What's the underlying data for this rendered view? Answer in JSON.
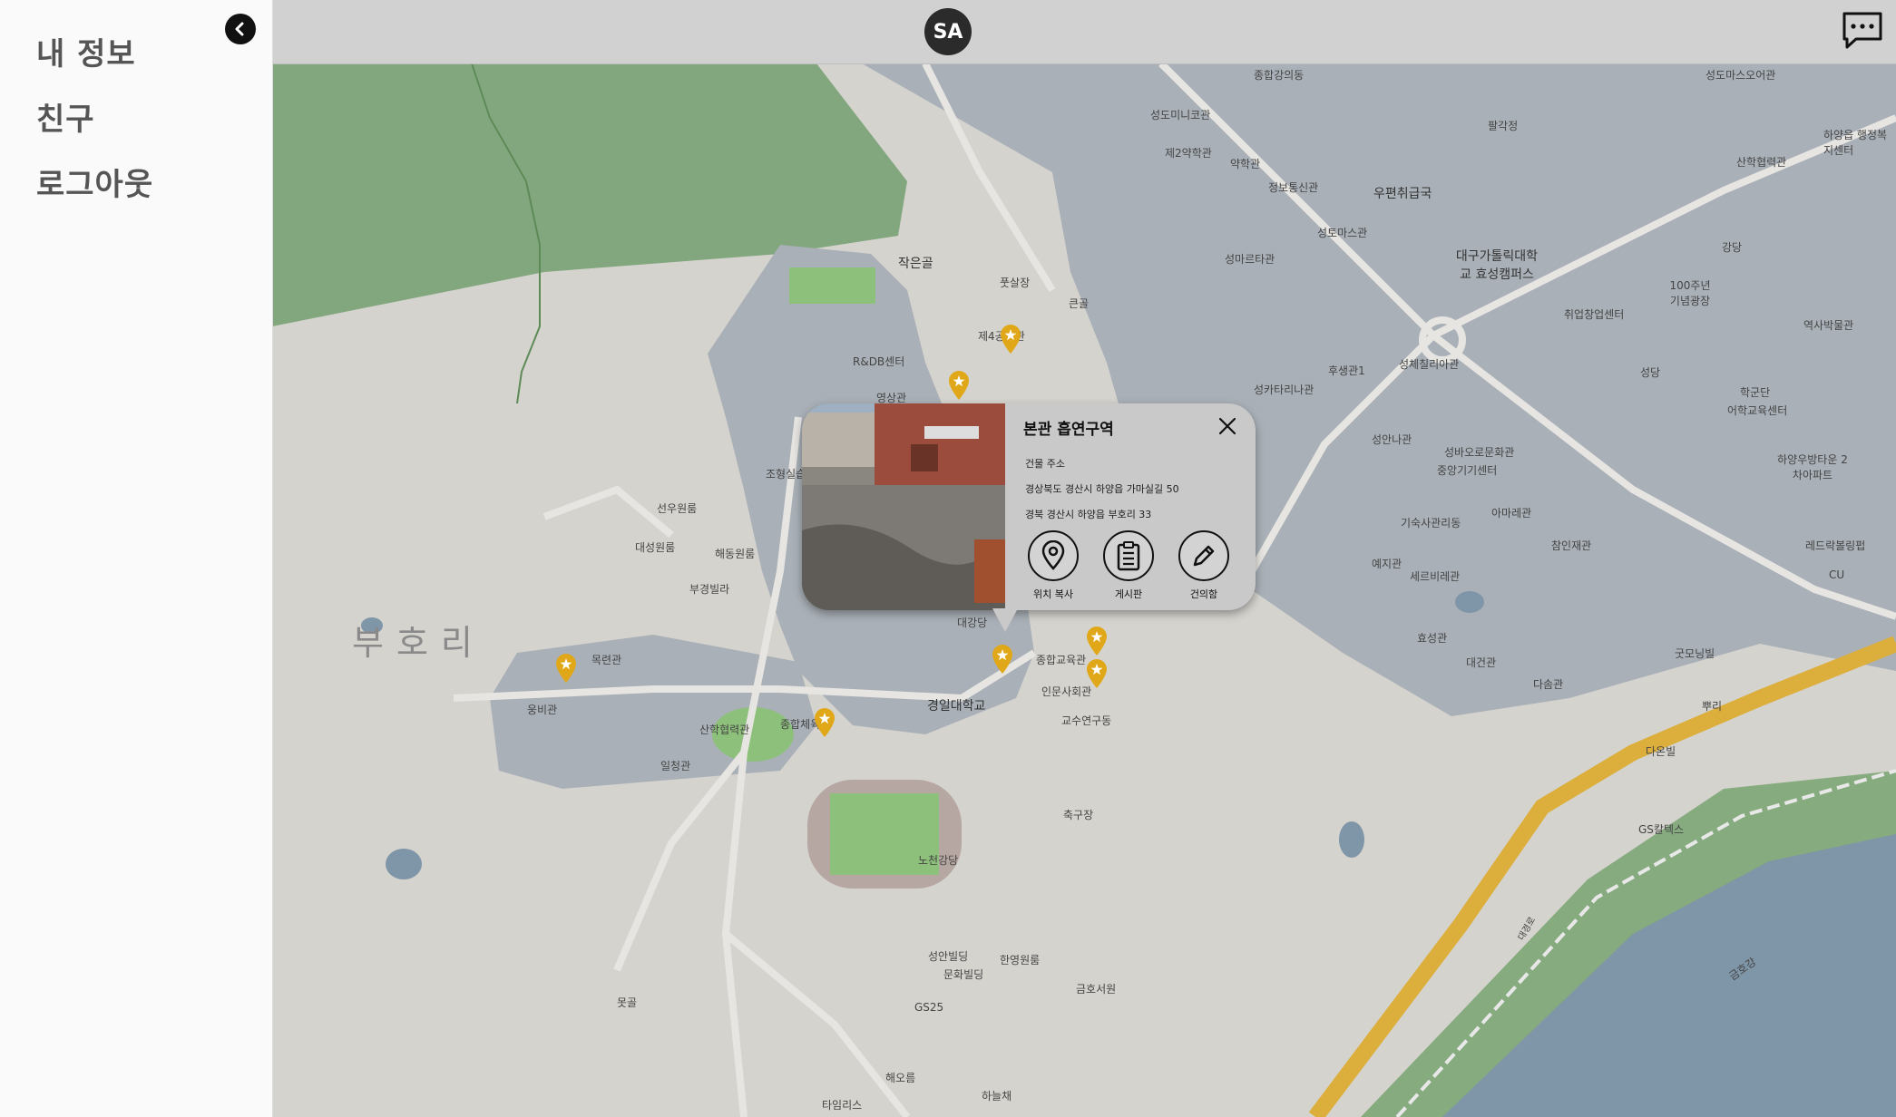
{
  "sidebar": {
    "items": [
      {
        "label": "내 정보"
      },
      {
        "label": "친구"
      },
      {
        "label": "로그아웃"
      }
    ]
  },
  "header": {
    "avatar_initials": "SA"
  },
  "map": {
    "region_label": "부호리",
    "labels": [
      "종합강의동",
      "성도마스오어관",
      "성도미니코관",
      "팔각정",
      "하양읍 행정복지센터",
      "제2약학관",
      "약학관",
      "정보통신관",
      "우편취급국",
      "산학협력관",
      "성토마스관",
      "성마르타관",
      "대구가톨릭대학교 효성캠퍼스",
      "강당",
      "100주년 기념광장",
      "작은골",
      "풋살장",
      "큰골",
      "취업창업센터",
      "역사박물관",
      "제4공학관",
      "R&DB센터",
      "후생관1",
      "성체칠리아관",
      "성카타리나관",
      "성당",
      "학군단",
      "어학교육센터",
      "영상관",
      "성안나관",
      "성바오로문화관",
      "하양우방타운 2차아파트",
      "조형실습관",
      "중앙기기센터",
      "선우원룸",
      "아마레관",
      "기숙사관리동",
      "대성원룸",
      "해동원룸",
      "예지관",
      "참인재관",
      "레드락볼링펍",
      "세르비레관",
      "부경빌라",
      "CU",
      "대강당",
      "효성관",
      "대건관",
      "다솜관",
      "굿모닝빌",
      "목련관",
      "종합교육관",
      "웅비관",
      "뿌리",
      "경일대학교",
      "인문사회관",
      "산학협력관",
      "종합체육관",
      "교수연구동",
      "일청관",
      "다온빌",
      "축구장",
      "GS칼텍스",
      "노천강당",
      "성안빌딩",
      "한영원룸",
      "문화빌딩",
      "금호서원",
      "GS25",
      "못골",
      "해오름",
      "하늘채",
      "타임리스",
      "금호강",
      "대경로"
    ]
  },
  "popup": {
    "title": "본관 흡연구역",
    "address_label": "건물 주소",
    "address_road": "경상북도 경산시 하양읍 가마실길 50",
    "address_jibun": "경북 경산시 하양읍 부호리 33",
    "buttons": [
      {
        "label": "위치 복사",
        "icon": "location-pin-icon"
      },
      {
        "label": "게시판",
        "icon": "clipboard-icon"
      },
      {
        "label": "건의함",
        "icon": "pencil-icon"
      }
    ]
  },
  "colors": {
    "marker": "#e0a819",
    "campus_area": "#a8b0b8",
    "forest": "#7fa47a",
    "river": "#7f95a8",
    "highway": "#e0b040"
  }
}
